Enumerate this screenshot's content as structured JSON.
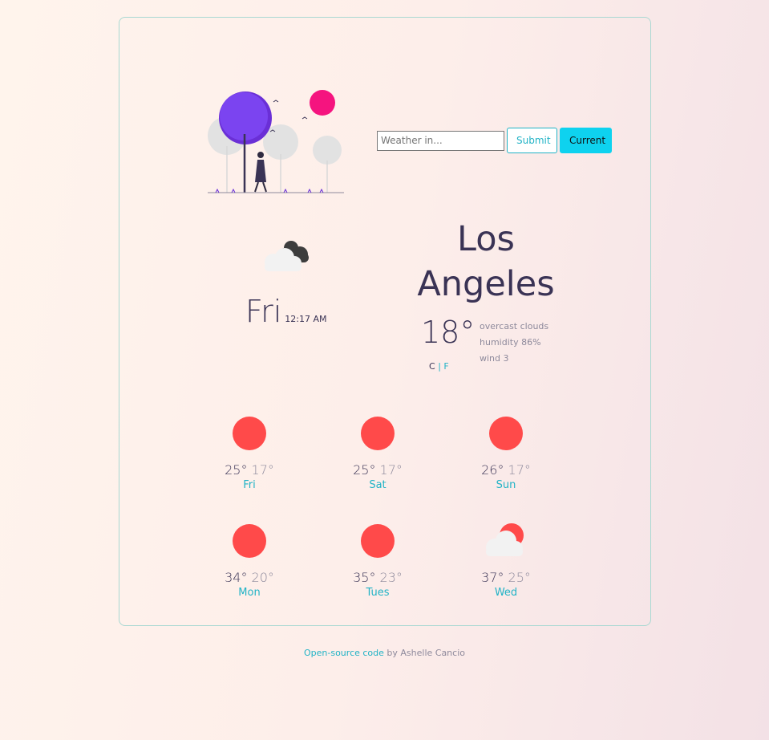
{
  "search": {
    "placeholder": "Weather in...",
    "submit_label": "Submit",
    "current_label": "Current"
  },
  "current": {
    "day": "Fri",
    "time": "12:17 AM",
    "city": "Los Angeles",
    "temperature": "18°",
    "unit_c": "C",
    "unit_sep": "|",
    "unit_f": "F",
    "description": "overcast clouds",
    "humidity": "humidity 86%",
    "wind": "wind 3",
    "icon": "overcast-clouds-icon"
  },
  "forecast": [
    {
      "high": "25°",
      "low": "17°",
      "day": "Fri",
      "icon": "sun-icon"
    },
    {
      "high": "25°",
      "low": "17°",
      "day": "Sat",
      "icon": "sun-icon"
    },
    {
      "high": "26°",
      "low": "17°",
      "day": "Sun",
      "icon": "sun-icon"
    },
    {
      "high": "34°",
      "low": "20°",
      "day": "Mon",
      "icon": "sun-icon"
    },
    {
      "high": "35°",
      "low": "23°",
      "day": "Tues",
      "icon": "sun-icon"
    },
    {
      "high": "37°",
      "low": "25°",
      "day": "Wed",
      "icon": "partly-cloudy-icon"
    }
  ],
  "footer": {
    "link_text": "Open-source code",
    "suffix": " by Ashelle Cancio"
  },
  "colors": {
    "accent": "#21b3c6",
    "button_primary": "#0ed2ef",
    "sun": "#ff4a4a",
    "text_dark": "#3a3355",
    "text_muted": "#8e8a9c"
  }
}
